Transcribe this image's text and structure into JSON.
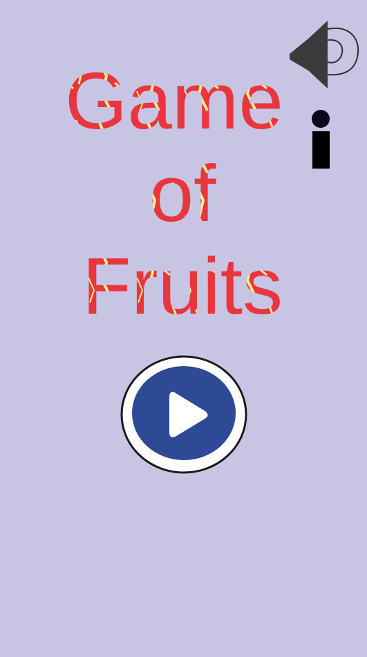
{
  "title": {
    "line1": "Game",
    "line2": "of",
    "line3": "Fruits"
  },
  "controls": {
    "sound_icon": "speaker-icon",
    "info_icon": "info-icon",
    "play_icon": "play-icon"
  },
  "colors": {
    "background": "#c7c5e3",
    "title_red": "#e9353d",
    "title_highlight": "#f7ee8e",
    "play_blue": "#2e4a96",
    "icon_dark": "#3b3b3b"
  }
}
